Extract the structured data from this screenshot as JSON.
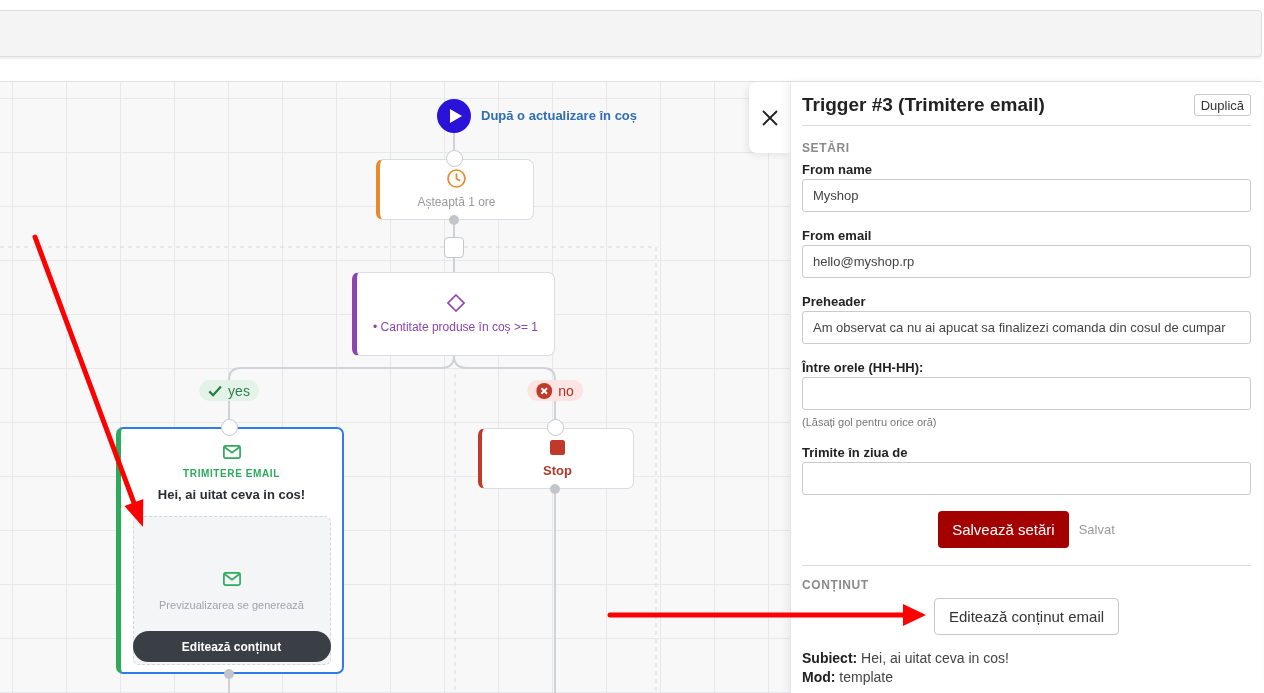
{
  "flow": {
    "trigger": {
      "label": "După o actualizare în coș"
    },
    "steps": [
      {
        "kind": "wait",
        "text": "Așteaptă 1 ore",
        "selected": false
      },
      {
        "kind": "condition",
        "text": "• Cantitate produse în coș >= 1",
        "selected": false
      }
    ],
    "branches": [
      {
        "kind": "yes",
        "label": "yes",
        "node": {
          "kind": "email",
          "type_label": "TRIMITERE EMAIL",
          "subject": "Hei, ai uitat ceva in cos!",
          "preview_text": "Previzualizarea se generează",
          "button": "Editează conținut",
          "selected": true
        }
      },
      {
        "kind": "no",
        "label": "no",
        "node": {
          "kind": "stop",
          "text": "Stop",
          "selected": false
        }
      }
    ]
  },
  "panel": {
    "title": "Trigger #3 (Trimitere email)",
    "duplicate_button": "Duplică",
    "settings_heading": "SETĂRI",
    "fields": [
      {
        "label": "From name",
        "value": "Myshop"
      },
      {
        "label": "From email",
        "value": "hello@myshop.rp"
      },
      {
        "label": "Preheader",
        "value": "Am observat ca nu ai apucat sa finalizezi comanda din cosul de cumpar"
      },
      {
        "label": "Între orele (HH-HH):",
        "hint": "(Lăsați gol pentru orice oră)"
      },
      {
        "label": "Trimite în ziua de"
      }
    ],
    "save_button": "Salvează setări",
    "save_status": "Salvat",
    "content_heading": "CONȚINUT",
    "edit_button": "Editează conținut email",
    "details": [
      "**Subiect:** Hei, ai uitat ceva in cos!",
      "**Mod:** template"
    ]
  }
}
